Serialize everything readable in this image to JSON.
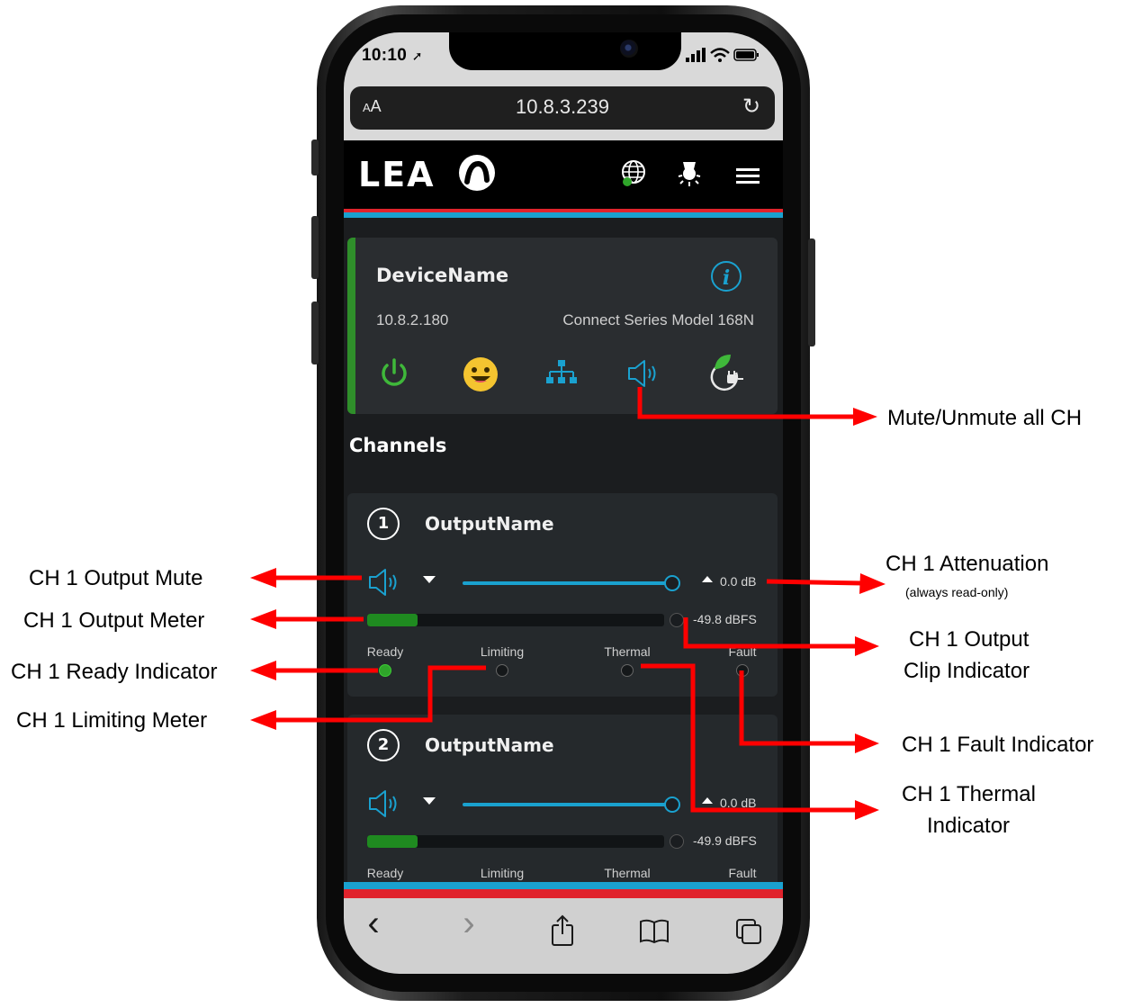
{
  "status_bar": {
    "time": "10:10",
    "location_glyph": "➚",
    "signal_icon": "cellular-signal-icon",
    "wifi_icon": "wifi-icon",
    "battery_icon": "battery-icon"
  },
  "browser": {
    "text_size_label": "AA",
    "url": "10.8.3.239",
    "reload_glyph": "↻"
  },
  "app_header": {
    "logo_text": "LEA",
    "icons": [
      "globe-icon",
      "light-icon",
      "menu-icon"
    ]
  },
  "device": {
    "name": "DeviceName",
    "ip": "10.8.2.180",
    "model": "Connect Series Model 168N",
    "info_glyph": "i",
    "status_icons": [
      "power-icon",
      "status-face-icon",
      "network-icon",
      "speaker-icon",
      "eco-power-icon"
    ]
  },
  "channels_heading": "Channels",
  "channels": [
    {
      "number": "1",
      "name": "OutputName",
      "attenuation": "0.0 dB",
      "meter_level": "-49.8 dBFS",
      "meter_fill": 0.17,
      "indicators": [
        {
          "label": "Ready",
          "on": true
        },
        {
          "label": "Limiting",
          "on": false
        },
        {
          "label": "Thermal",
          "on": false
        },
        {
          "label": "Fault",
          "on": false
        }
      ]
    },
    {
      "number": "2",
      "name": "OutputName",
      "attenuation": "0.0 dB",
      "meter_level": "-49.9 dBFS",
      "meter_fill": 0.17,
      "indicators": [
        {
          "label": "Ready",
          "on": true
        },
        {
          "label": "Limiting",
          "on": false
        },
        {
          "label": "Thermal",
          "on": false
        },
        {
          "label": "Fault",
          "on": false
        }
      ]
    }
  ],
  "toolbar": {
    "back": "‹",
    "forward": "›",
    "icons": [
      "back-icon",
      "forward-icon",
      "share-icon",
      "bookmarks-icon",
      "tabs-icon"
    ]
  },
  "callouts": {
    "mute_all": "Mute/Unmute all CH",
    "ch1_attenuation": "CH 1 Attenuation",
    "ch1_attenuation_note": "(always read-only)",
    "ch1_output_mute": "CH 1 Output Mute",
    "ch1_output_meter": "CH 1 Output Meter",
    "ch1_clip_line1": "CH 1 Output",
    "ch1_clip_line2": "Clip Indicator",
    "ch1_ready": "CH 1 Ready Indicator",
    "ch1_limiting": "CH 1 Limiting Meter",
    "ch1_fault": "CH 1 Fault Indicator",
    "ch1_thermal_line1": "CH 1 Thermal",
    "ch1_thermal_line2": "Indicator"
  },
  "colors": {
    "accent_blue": "#1aa1cf",
    "stripe_red": "#e0232c",
    "ready_green": "#2fa52a",
    "device_accent": "#2f8f2a",
    "arrow_red": "#ff0000"
  }
}
